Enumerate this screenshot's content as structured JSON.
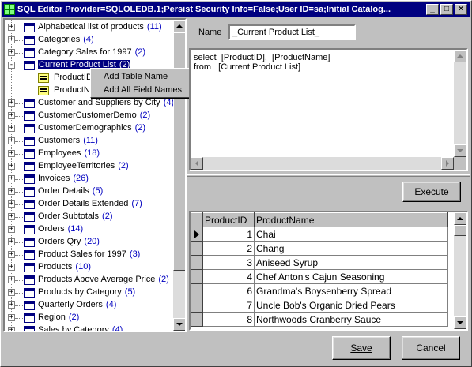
{
  "window": {
    "title": "SQL Editor Provider=SQLOLEDB.1;Persist Security Info=False;User ID=sa;Initial Catalog..."
  },
  "tree": {
    "items": [
      {
        "label": "Alphabetical list of products",
        "count": "(11)",
        "expander": "+"
      },
      {
        "label": "Categories",
        "count": "(4)",
        "expander": "+"
      },
      {
        "label": "Category Sales for 1997",
        "count": "(2)",
        "expander": "+"
      },
      {
        "label": "Current Product List",
        "count": "(2)",
        "expander": "-",
        "selected": true
      },
      {
        "label": "ProductID",
        "child": true
      },
      {
        "label": "ProductName",
        "child": true
      },
      {
        "label": "Customer and Suppliers by City",
        "count": "(4)",
        "expander": "+"
      },
      {
        "label": "CustomerCustomerDemo",
        "count": "(2)",
        "expander": "+"
      },
      {
        "label": "CustomerDemographics",
        "count": "(2)",
        "expander": "+"
      },
      {
        "label": "Customers",
        "count": "(11)",
        "expander": "+"
      },
      {
        "label": "Employees",
        "count": "(18)",
        "expander": "+"
      },
      {
        "label": "EmployeeTerritories",
        "count": "(2)",
        "expander": "+"
      },
      {
        "label": "Invoices",
        "count": "(26)",
        "expander": "+"
      },
      {
        "label": "Order Details",
        "count": "(5)",
        "expander": "+"
      },
      {
        "label": "Order Details Extended",
        "count": "(7)",
        "expander": "+"
      },
      {
        "label": "Order Subtotals",
        "count": "(2)",
        "expander": "+"
      },
      {
        "label": "Orders",
        "count": "(14)",
        "expander": "+"
      },
      {
        "label": "Orders Qry",
        "count": "(20)",
        "expander": "+"
      },
      {
        "label": "Product Sales for 1997",
        "count": "(3)",
        "expander": "+"
      },
      {
        "label": "Products",
        "count": "(10)",
        "expander": "+"
      },
      {
        "label": "Products Above Average Price",
        "count": "(2)",
        "expander": "+"
      },
      {
        "label": "Products by Category",
        "count": "(5)",
        "expander": "+"
      },
      {
        "label": "Quarterly Orders",
        "count": "(4)",
        "expander": "+"
      },
      {
        "label": "Region",
        "count": "(2)",
        "expander": "+"
      },
      {
        "label": "Sales by Category",
        "count": "(4)",
        "expander": "+"
      }
    ]
  },
  "context_menu": {
    "items": [
      "Add Table Name",
      "Add All Field Names"
    ]
  },
  "editor": {
    "name_label": "Name",
    "name_value": "_Current Product List_",
    "sql_text": "select  [ProductID],  [ProductName]\nfrom   [Current Product List]"
  },
  "execute_label": "Execute",
  "grid": {
    "columns": [
      "ProductID",
      "ProductName"
    ],
    "rows": [
      {
        "id": "1",
        "name": "Chai"
      },
      {
        "id": "2",
        "name": "Chang"
      },
      {
        "id": "3",
        "name": "Aniseed Syrup"
      },
      {
        "id": "4",
        "name": "Chef Anton's Cajun Seasoning"
      },
      {
        "id": "6",
        "name": "Grandma's Boysenberry Spread"
      },
      {
        "id": "7",
        "name": "Uncle Bob's Organic Dried Pears"
      },
      {
        "id": "8",
        "name": "Northwoods Cranberry Sauce"
      }
    ]
  },
  "footer": {
    "save_label": "Save",
    "cancel_label": "Cancel"
  },
  "colors": {
    "title_bar": "#000080",
    "face": "#c0c0c0",
    "count_text": "#0000c0"
  }
}
